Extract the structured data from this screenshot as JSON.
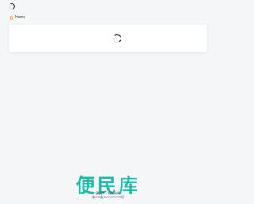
{
  "breadcrumb": {
    "home_label": "Home",
    "home_icon": "home-icon"
  },
  "loading": {
    "card_spinner_icon": "spinner-icon",
    "top_spinner_icon": "spinner-icon"
  },
  "footer": {
    "brand_text": "便民库",
    "brand_color": "#18b9a6",
    "line1": "便民库 · 版权所有",
    "icp": "湘ICP备2023002373号"
  }
}
